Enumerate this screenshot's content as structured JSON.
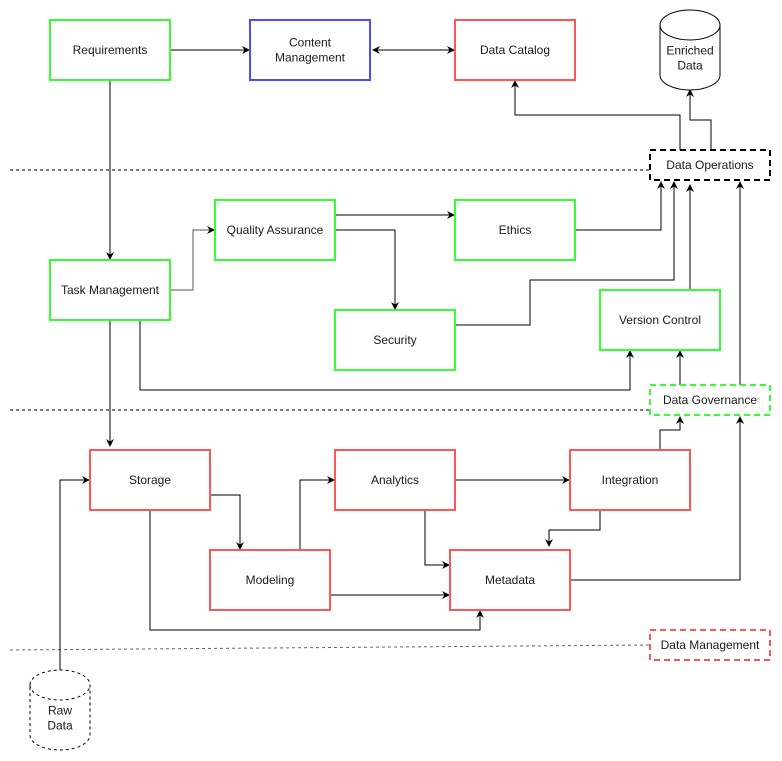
{
  "colors": {
    "green": "#33ff33",
    "blue": "#4d4dff",
    "red": "#ff5555",
    "black": "#000000",
    "dashed_line": "#666666"
  },
  "nodes": {
    "requirements": {
      "label": [
        "Requirements"
      ],
      "group": "green"
    },
    "content_management": {
      "label": [
        "Content",
        "Management"
      ],
      "group": "blue"
    },
    "data_catalog": {
      "label": [
        "Data Catalog"
      ],
      "group": "red"
    },
    "enriched_data": {
      "label": [
        "Enriched",
        "Data"
      ],
      "group": "black"
    },
    "data_operations": {
      "label": [
        "Data Operations"
      ],
      "group": "black"
    },
    "quality_assurance": {
      "label": [
        "Quality Assurance"
      ],
      "group": "green"
    },
    "ethics": {
      "label": [
        "Ethics"
      ],
      "group": "green"
    },
    "task_management": {
      "label": [
        "Task Management"
      ],
      "group": "green"
    },
    "security": {
      "label": [
        "Security"
      ],
      "group": "green"
    },
    "version_control": {
      "label": [
        "Version Control"
      ],
      "group": "green"
    },
    "data_governance": {
      "label": [
        "Data Governance"
      ],
      "group": "green"
    },
    "storage": {
      "label": [
        "Storage"
      ],
      "group": "red"
    },
    "analytics": {
      "label": [
        "Analytics"
      ],
      "group": "red"
    },
    "integration": {
      "label": [
        "Integration"
      ],
      "group": "red"
    },
    "modeling": {
      "label": [
        "Modeling"
      ],
      "group": "red"
    },
    "metadata": {
      "label": [
        "Metadata"
      ],
      "group": "red"
    },
    "data_management": {
      "label": [
        "Data Management"
      ],
      "group": "red"
    },
    "raw_data": {
      "label": [
        "Raw",
        "Data"
      ],
      "group": "black"
    }
  },
  "edges": [
    {
      "from": "requirements",
      "to": "content_management"
    },
    {
      "from": "content_management",
      "to": "data_catalog",
      "bidirectional": true
    },
    {
      "from": "requirements",
      "to": "task_management"
    },
    {
      "from": "task_management",
      "to": "quality_assurance"
    },
    {
      "from": "quality_assurance",
      "to": "ethics"
    },
    {
      "from": "quality_assurance",
      "to": "security"
    },
    {
      "from": "ethics",
      "to": "data_operations"
    },
    {
      "from": "security",
      "to": "data_operations"
    },
    {
      "from": "version_control",
      "to": "data_operations"
    },
    {
      "from": "data_governance",
      "to": "data_operations"
    },
    {
      "from": "data_operations",
      "to": "data_catalog"
    },
    {
      "from": "data_operations",
      "to": "enriched_data"
    },
    {
      "from": "task_management",
      "to": "version_control"
    },
    {
      "from": "data_governance",
      "to": "version_control"
    },
    {
      "from": "task_management",
      "to": "storage"
    },
    {
      "from": "raw_data",
      "to": "storage"
    },
    {
      "from": "storage",
      "to": "modeling"
    },
    {
      "from": "storage",
      "to": "metadata"
    },
    {
      "from": "modeling",
      "to": "analytics"
    },
    {
      "from": "modeling",
      "to": "metadata"
    },
    {
      "from": "analytics",
      "to": "integration"
    },
    {
      "from": "analytics",
      "to": "metadata"
    },
    {
      "from": "integration",
      "to": "metadata"
    },
    {
      "from": "integration",
      "to": "data_governance"
    },
    {
      "from": "metadata",
      "to": "data_governance"
    }
  ]
}
